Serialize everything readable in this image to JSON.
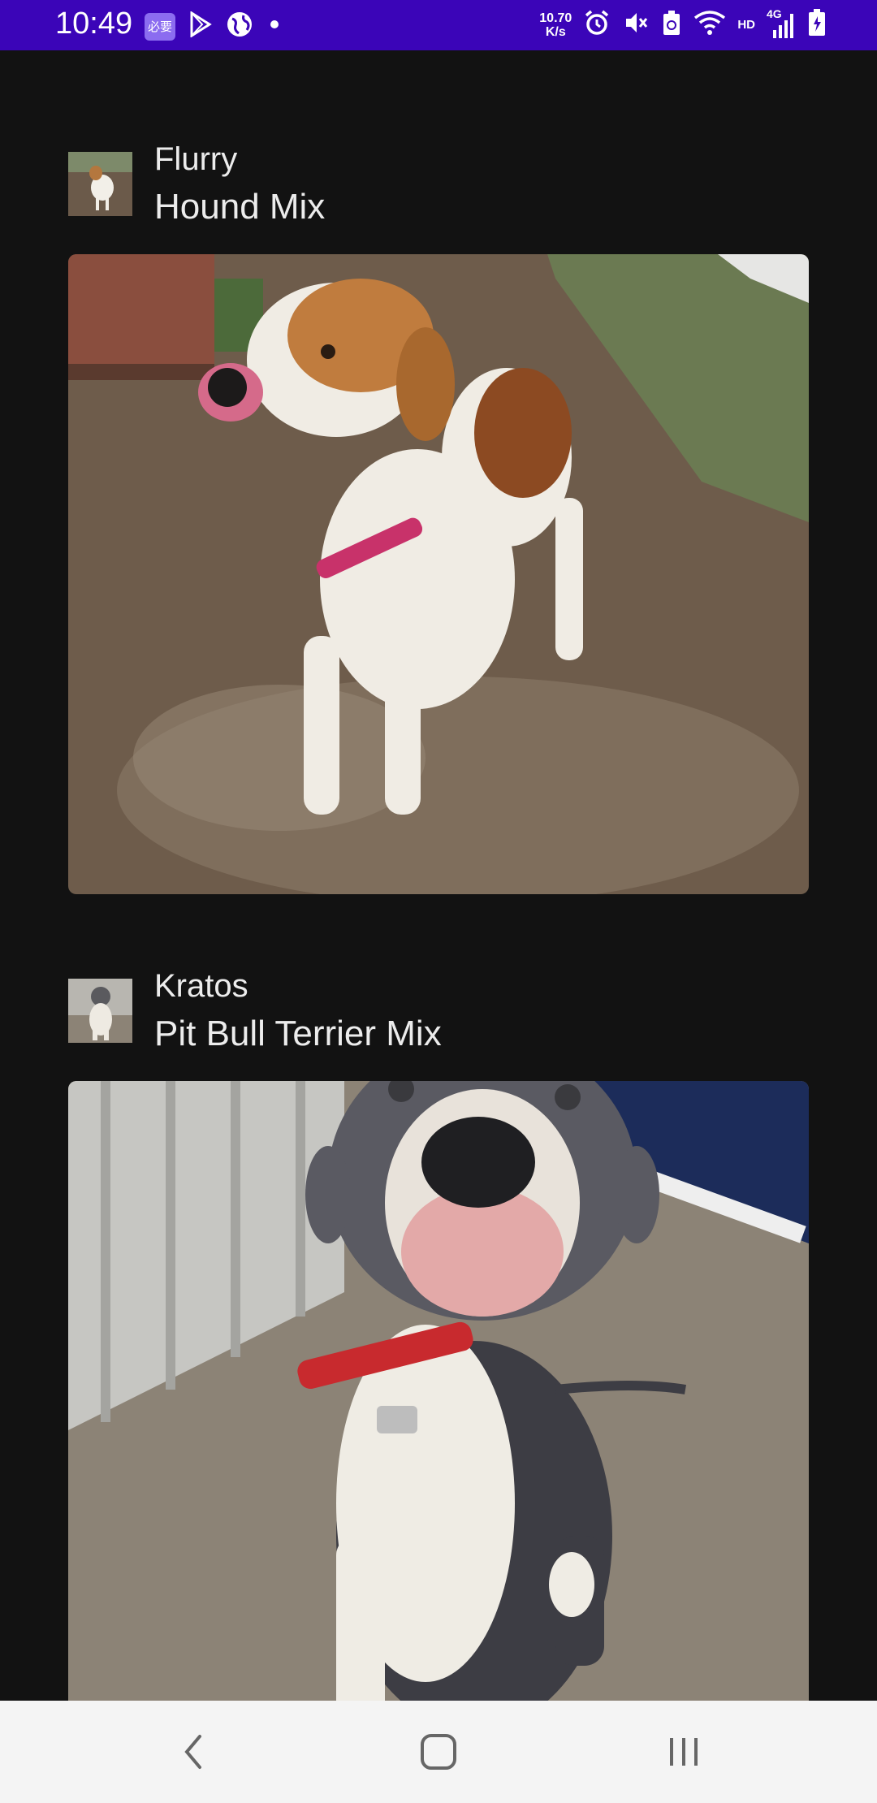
{
  "status_bar": {
    "time": "10:49",
    "app_badge": "必要",
    "speed_value": "10.70",
    "speed_unit": "K/s",
    "network_label": "HD",
    "network_gen": "4G",
    "icons": [
      "play-store-icon",
      "globe-icon",
      "dot-icon",
      "alarm-icon",
      "mute-icon",
      "recycle-icon",
      "wifi-icon",
      "signal-icon",
      "battery-icon"
    ],
    "background_color": "#3b05b8"
  },
  "pets": [
    {
      "name": "Flurry",
      "breed": "Hound Mix",
      "thumbnail_icon": "dog-thumbnail",
      "photo_icon": "hound-dog-photo"
    },
    {
      "name": "Kratos",
      "breed": "Pit Bull Terrier Mix",
      "thumbnail_icon": "dog-thumbnail",
      "photo_icon": "pit-bull-dog-photo"
    }
  ],
  "nav_bar": {
    "buttons": [
      "back",
      "home",
      "recents"
    ]
  },
  "colors": {
    "background": "#121212",
    "text": "#ececec",
    "nav_background": "#f4f4f4"
  }
}
